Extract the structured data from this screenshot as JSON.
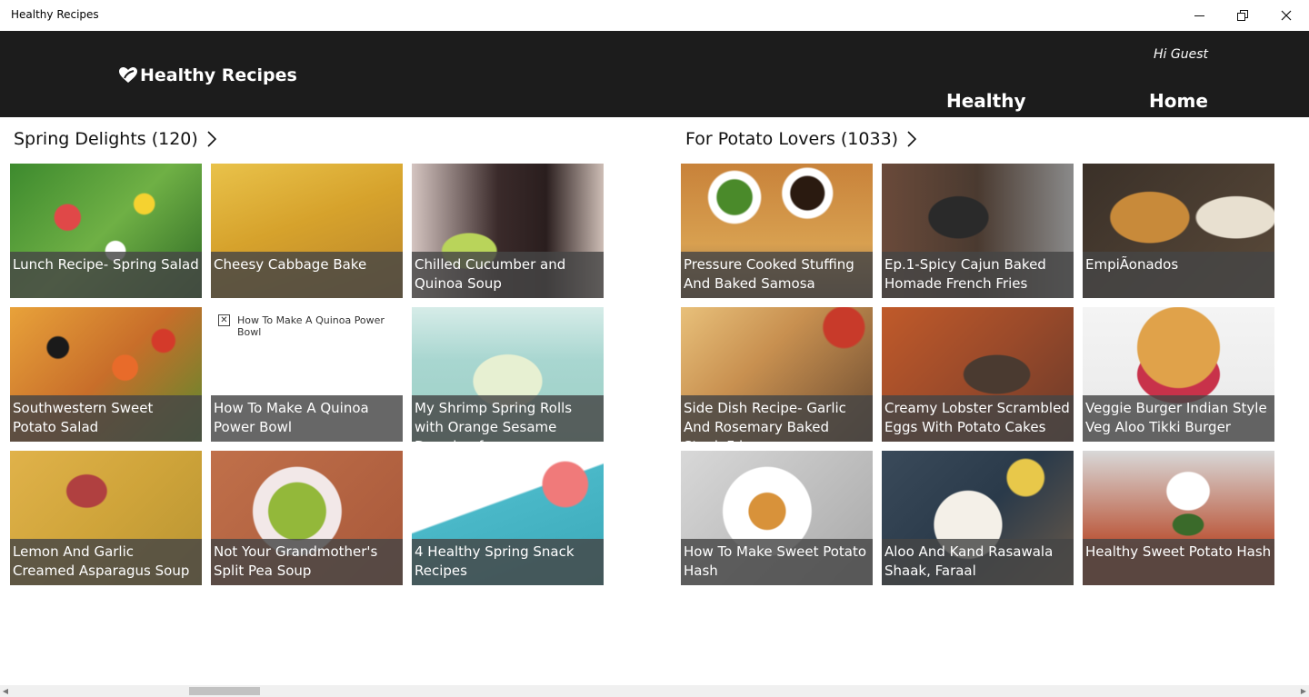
{
  "window": {
    "title": "Healthy Recipes",
    "controls": [
      "minimize-icon",
      "restore-icon",
      "close-icon"
    ]
  },
  "header": {
    "logo_text": "Healthy Recipes",
    "greeting": "Hi Guest",
    "nav": [
      {
        "label": "Healthy"
      },
      {
        "label": "Home"
      }
    ],
    "background": "#1c1c1c"
  },
  "sections": [
    {
      "title": "Spring Delights (120)",
      "tiles": [
        {
          "caption": "Lunch Recipe- Spring Salad"
        },
        {
          "caption": "Cheesy Cabbage Bake"
        },
        {
          "caption": "Chilled Cucumber and Quinoa Soup"
        },
        {
          "caption": "Southwestern Sweet Potato Salad"
        },
        {
          "caption": "How To Make A Quinoa Power Bowl",
          "missing_image_alt": "How To Make A Quinoa Power Bowl"
        },
        {
          "caption": "My Shrimp Spring Rolls with Orange Sesame Dressing for"
        },
        {
          "caption": "Lemon And Garlic Creamed Asparagus Soup"
        },
        {
          "caption": "Not Your Grandmother's Split Pea Soup"
        },
        {
          "caption": "4 Healthy Spring Snack Recipes"
        }
      ]
    },
    {
      "title": "For Potato Lovers (1033)",
      "tiles": [
        {
          "caption": "Pressure Cooked Stuffing And Baked Samosa"
        },
        {
          "caption": "Ep.1-Spicy Cajun Baked Homade French Fries"
        },
        {
          "caption": "EmpiÃonados"
        },
        {
          "caption": "Side Dish Recipe- Garlic And Rosemary Baked Steak Fries"
        },
        {
          "caption": "Creamy Lobster Scrambled Eggs With Potato Cakes"
        },
        {
          "caption": "Veggie Burger Indian Style Veg Aloo Tikki Burger"
        },
        {
          "caption": "How To Make Sweet Potato Hash"
        },
        {
          "caption": "Aloo And Kand Rasawala Shaak, Faraal"
        },
        {
          "caption": "Healthy Sweet Potato Hash"
        }
      ]
    }
  ]
}
